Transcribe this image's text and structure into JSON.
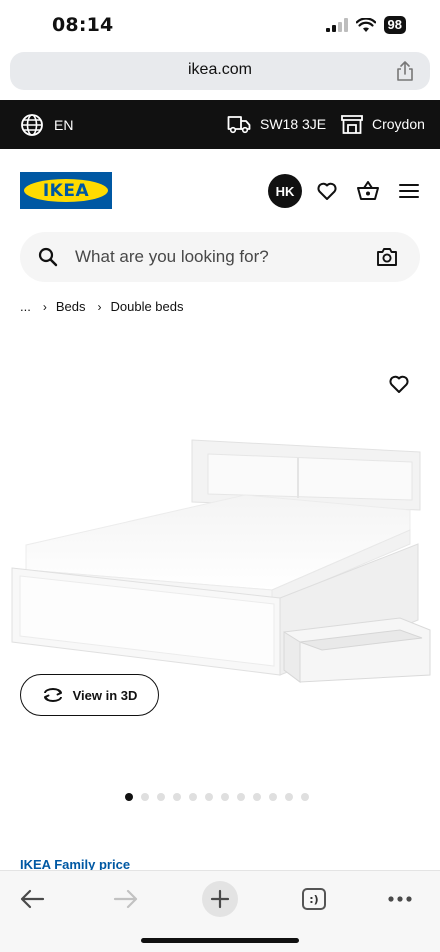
{
  "status_bar": {
    "time": "08:14",
    "battery": "98"
  },
  "browser": {
    "url": "ikea.com"
  },
  "utility_bar": {
    "language": "EN",
    "postcode": "SW18 3JE",
    "store": "Croydon"
  },
  "header": {
    "logo_text": "IKEA",
    "avatar_initials": "HK"
  },
  "search": {
    "placeholder": "What are you looking for?"
  },
  "breadcrumb": {
    "ellipsis": "...",
    "items": [
      "Beds",
      "Double beds"
    ]
  },
  "product": {
    "view_3d_label": "View in 3D",
    "image_count": 12,
    "active_image_index": 0,
    "family_price_label": "IKEA Family price"
  },
  "colors": {
    "ikea_blue": "#0058a3",
    "ikea_yellow": "#ffdb00",
    "utility_bar_bg": "#111111"
  },
  "icons": {
    "language": "globe-icon",
    "postcode": "truck-icon",
    "store": "store-icon",
    "favourites": "heart-icon",
    "basket": "basket-icon",
    "menu": "hamburger-icon",
    "search": "search-icon",
    "visual_search": "camera-icon",
    "share": "share-icon",
    "view_3d": "rotate-3d-icon"
  },
  "toolbar": {
    "tabs_glyph": ":)"
  }
}
